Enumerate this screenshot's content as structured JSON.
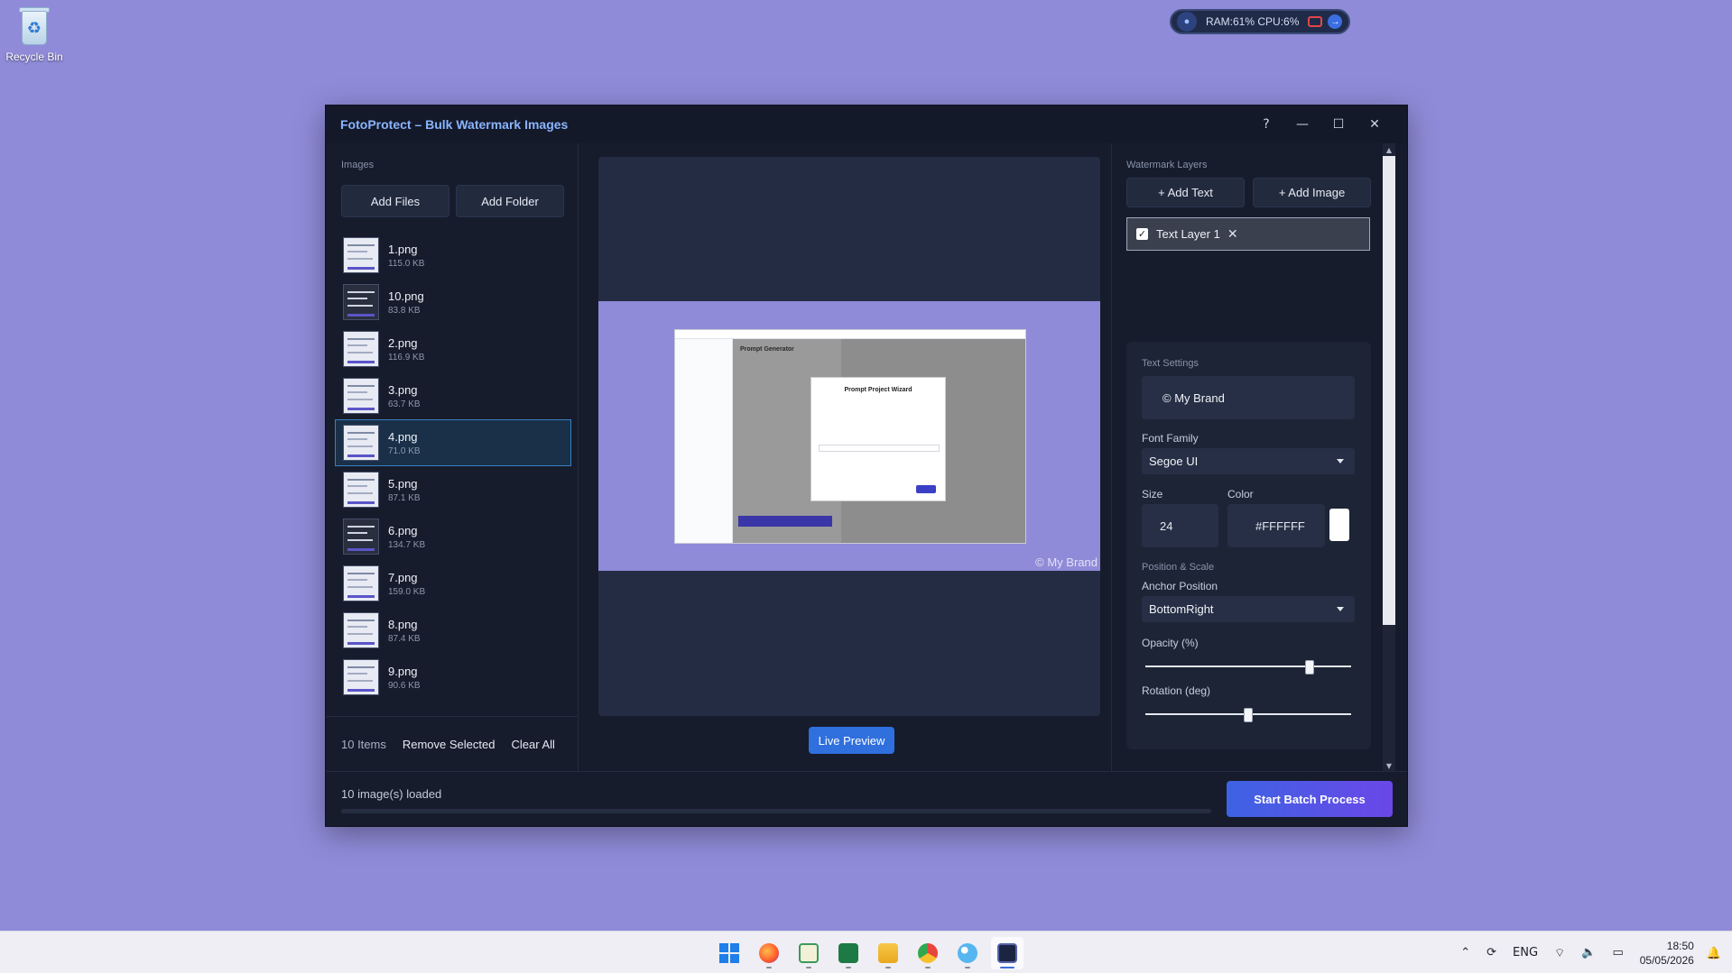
{
  "desktop": {
    "recycle_bin_label": "Recycle Bin"
  },
  "system_monitor": {
    "text": "RAM:61%  CPU:6%"
  },
  "window": {
    "title": "FotoProtect – Bulk Watermark Images",
    "controls": {
      "help": "?",
      "minimize": "—",
      "maximize": "☐",
      "close": "✕"
    }
  },
  "images_panel": {
    "label": "Images",
    "add_files": "Add Files",
    "add_folder": "Add Folder",
    "files": [
      {
        "name": "1.png",
        "size": "115.0 KB"
      },
      {
        "name": "10.png",
        "size": "83.8 KB"
      },
      {
        "name": "2.png",
        "size": "116.9 KB"
      },
      {
        "name": "3.png",
        "size": "63.7 KB"
      },
      {
        "name": "4.png",
        "size": "71.0 KB"
      },
      {
        "name": "5.png",
        "size": "87.1 KB"
      },
      {
        "name": "6.png",
        "size": "134.7 KB"
      },
      {
        "name": "7.png",
        "size": "159.0 KB"
      },
      {
        "name": "8.png",
        "size": "87.4 KB"
      },
      {
        "name": "9.png",
        "size": "90.6 KB"
      }
    ],
    "selected_index": 4,
    "item_count": "10 Items",
    "remove_selected": "Remove Selected",
    "clear_all": "Clear All"
  },
  "preview": {
    "mini_heading": "Prompt Generator",
    "mini_dialog_title": "Prompt Project Wizard",
    "watermark_text": "© My Brand",
    "live_preview_button": "Live Preview"
  },
  "layers_panel": {
    "label": "Watermark Layers",
    "add_text": "+ Add Text",
    "add_image": "+ Add Image",
    "layers": [
      {
        "name": "Text Layer 1",
        "checked": true
      }
    ]
  },
  "text_settings": {
    "label": "Text Settings",
    "text_value": "© My Brand",
    "font_family_label": "Font Family",
    "font_family_value": "Segoe UI",
    "size_label": "Size",
    "size_value": "24",
    "color_label": "Color",
    "color_value": "#FFFFFF",
    "position_scale_label": "Position & Scale",
    "anchor_label": "Anchor Position",
    "anchor_value": "BottomRight",
    "opacity_label": "Opacity (%)",
    "opacity_fraction": 0.8,
    "rotation_label": "Rotation (deg)",
    "rotation_fraction": 0.5
  },
  "status": {
    "text": "10 image(s) loaded",
    "progress_fraction": 0,
    "start_button": "Start Batch Process"
  },
  "taskbar": {
    "language": "ENG",
    "time": "18:50",
    "date": "05/05/2026",
    "apps": [
      "windows-start",
      "firefox",
      "notepad",
      "excel",
      "file-explorer",
      "chrome",
      "paint",
      "fotoprotect"
    ]
  },
  "colors": {
    "desktop": "#8f8bd8",
    "accent": "#2f6fde",
    "title": "#8ab4ff"
  }
}
